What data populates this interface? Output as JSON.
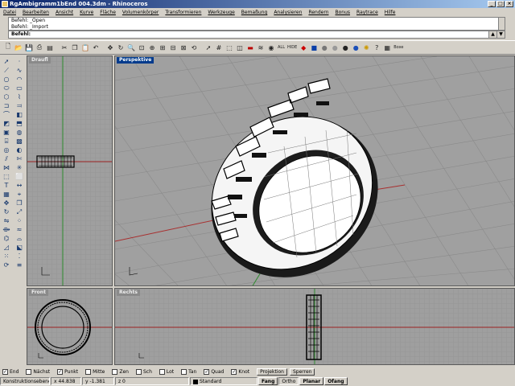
{
  "window": {
    "title": "RgAmbigramm1bEnd 004.3dm - Rhinoceros"
  },
  "menu": [
    "Datei",
    "Bearbeiten",
    "Ansicht",
    "Kurve",
    "Fläche",
    "Volumenkörper",
    "Transformieren",
    "Werkzeuge",
    "Bemaßung",
    "Analysieren",
    "Rendern",
    "Bonus",
    "Raytrace",
    "Hilfe"
  ],
  "command": {
    "history": [
      "Befehl: _Open",
      "Befehl: _Import"
    ],
    "prompt": "Befehl:"
  },
  "toolbar": {
    "boxedit_label": "Boxe"
  },
  "viewports": {
    "top": {
      "label": "Draufl"
    },
    "perspective": {
      "label": "Perspektive"
    },
    "front": {
      "label": "Front"
    },
    "right": {
      "label": "Rechts"
    }
  },
  "osnap": {
    "items": [
      {
        "label": "End",
        "checked": true
      },
      {
        "label": "Nächst",
        "checked": false
      },
      {
        "label": "Punkt",
        "checked": true
      },
      {
        "label": "Mitte",
        "checked": false
      },
      {
        "label": "Zen",
        "checked": false
      },
      {
        "label": "Sch",
        "checked": false
      },
      {
        "label": "Lot",
        "checked": false
      },
      {
        "label": "Tan",
        "checked": false
      },
      {
        "label": "Quad",
        "checked": true
      },
      {
        "label": "Knot",
        "checked": true
      }
    ],
    "projection_label": "Projektion",
    "lock_label": "Sperren"
  },
  "status": {
    "cplane": "Konstruktionsebene",
    "x": "x 44.838",
    "y": "y -1.381",
    "z": "z 0",
    "layer": "Standard",
    "snap": "Fang",
    "ortho": "Ortho",
    "planar": "Planar",
    "osnap": "Ofang"
  }
}
